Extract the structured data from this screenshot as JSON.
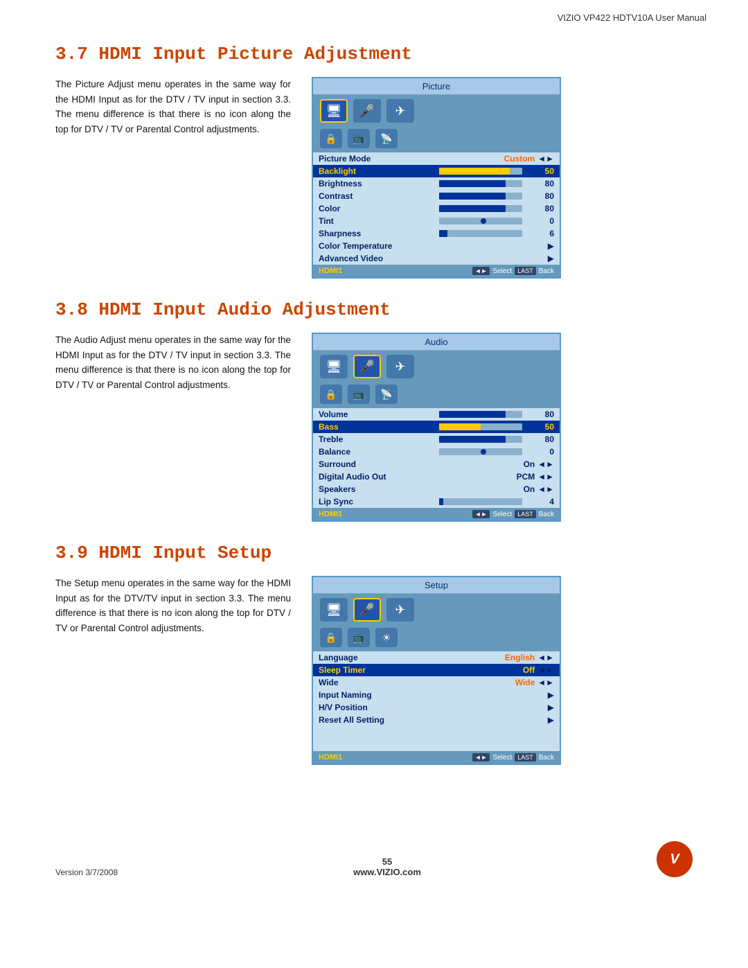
{
  "header": {
    "title": "VIZIO VP422 HDTV10A User Manual"
  },
  "section37": {
    "title": "3.7 HDMI Input Picture Adjustment",
    "text": "The Picture Adjust menu operates in the same way for the HDMI Input as for the DTV / TV input in section 3.3.  The menu difference is that there is no icon along the top for DTV / TV or Parental Control adjustments.",
    "menu": {
      "title": "Picture",
      "rows": [
        {
          "label": "Picture Mode",
          "value": "Custom",
          "type": "value",
          "highlighted": false,
          "value_color": "orange"
        },
        {
          "label": "Backlight",
          "value": "50",
          "type": "bar",
          "fill": 85,
          "fill_color": "yellow",
          "highlighted": true
        },
        {
          "label": "Brightness",
          "value": "80",
          "type": "bar",
          "fill": 80,
          "fill_color": "blue",
          "highlighted": false
        },
        {
          "label": "Contrast",
          "value": "80",
          "type": "bar",
          "fill": 80,
          "fill_color": "blue",
          "highlighted": false
        },
        {
          "label": "Color",
          "value": "80",
          "type": "bar",
          "fill": 80,
          "fill_color": "blue",
          "highlighted": false
        },
        {
          "label": "Tint",
          "value": "0",
          "type": "bar-dot",
          "highlighted": false
        },
        {
          "label": "Sharpness",
          "value": "6",
          "type": "bar",
          "fill": 10,
          "fill_color": "blue",
          "highlighted": false
        },
        {
          "label": "Color Temperature",
          "value": "",
          "type": "arrow",
          "highlighted": false
        },
        {
          "label": "Advanced Video",
          "value": "",
          "type": "arrow",
          "highlighted": false
        }
      ],
      "footer_left": "HDMI1",
      "footer_nav": "◄► Select",
      "footer_back": "LAST Back"
    }
  },
  "section38": {
    "title": "3.8 HDMI Input Audio Adjustment",
    "text": "The Audio Adjust menu operates in the same way for the HDMI Input as for the DTV / TV input in section 3.3.  The menu difference is that there is no icon along the top for DTV / TV or Parental Control adjustments.",
    "menu": {
      "title": "Audio",
      "rows": [
        {
          "label": "Volume",
          "value": "80",
          "type": "bar",
          "fill": 80,
          "fill_color": "blue",
          "highlighted": false
        },
        {
          "label": "Bass",
          "value": "50",
          "type": "bar",
          "fill": 50,
          "fill_color": "yellow",
          "highlighted": true
        },
        {
          "label": "Treble",
          "value": "80",
          "type": "bar",
          "fill": 80,
          "fill_color": "blue",
          "highlighted": false
        },
        {
          "label": "Balance",
          "value": "0",
          "type": "bar-dot",
          "highlighted": false
        },
        {
          "label": "Surround",
          "value": "On",
          "type": "value-arrow",
          "highlighted": false
        },
        {
          "label": "Digital Audio Out",
          "value": "PCM",
          "type": "value-arrow",
          "highlighted": false
        },
        {
          "label": "Speakers",
          "value": "On",
          "type": "value-arrow",
          "highlighted": false
        },
        {
          "label": "Lip Sync",
          "value": "4",
          "type": "bar",
          "fill": 5,
          "fill_color": "blue",
          "highlighted": false
        }
      ],
      "footer_left": "HDMI1",
      "footer_nav": "◄► Select",
      "footer_back": "LAST Back"
    }
  },
  "section39": {
    "title": "3.9 HDMI Input Setup",
    "text": "The Setup menu operates in the same way for the HDMI Input as for the DTV/TV input in section 3.3.  The menu difference is that there is no icon along the top for DTV / TV or Parental Control adjustments.",
    "menu": {
      "title": "Setup",
      "rows": [
        {
          "label": "Language",
          "value": "English",
          "type": "value-arrow",
          "highlighted": false,
          "value_color": "orange"
        },
        {
          "label": "Sleep Timer",
          "value": "Off",
          "type": "value-arrow",
          "highlighted": true,
          "value_color": "orange"
        },
        {
          "label": "Wide",
          "value": "Wide",
          "type": "value-arrow",
          "highlighted": false,
          "value_color": "orange"
        },
        {
          "label": "Input Naming",
          "value": "",
          "type": "arrow",
          "highlighted": false
        },
        {
          "label": "H/V Position",
          "value": "",
          "type": "arrow",
          "highlighted": false
        },
        {
          "label": "Reset All Setting",
          "value": "",
          "type": "arrow",
          "highlighted": false
        }
      ],
      "footer_left": "HDMI1",
      "footer_nav": "◄► Select",
      "footer_back": "LAST Back"
    }
  },
  "footer": {
    "version": "Version 3/7/2008",
    "page": "55",
    "website": "www.VIZIO.com",
    "logo_text": "V"
  }
}
